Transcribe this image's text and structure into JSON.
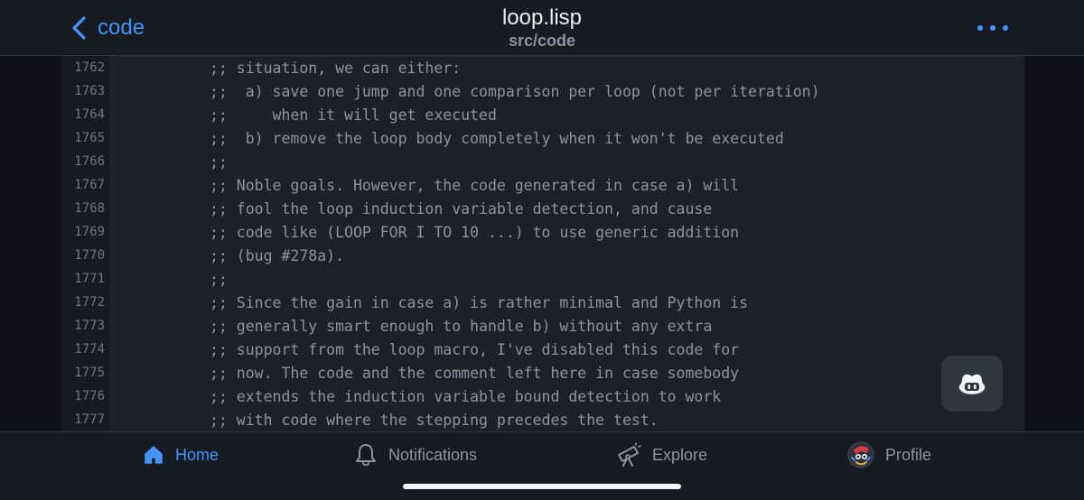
{
  "header": {
    "back_label": "code",
    "title": "loop.lisp",
    "subtitle": "src/code"
  },
  "code": {
    "lines": [
      {
        "num": "1762",
        "text": ";; situation, we can either:"
      },
      {
        "num": "1763",
        "text": ";;  a) save one jump and one comparison per loop (not per iteration)"
      },
      {
        "num": "1764",
        "text": ";;     when it will get executed"
      },
      {
        "num": "1765",
        "text": ";;  b) remove the loop body completely when it won't be executed"
      },
      {
        "num": "1766",
        "text": ";;"
      },
      {
        "num": "1767",
        "text": ";; Noble goals. However, the code generated in case a) will"
      },
      {
        "num": "1768",
        "text": ";; fool the loop induction variable detection, and cause"
      },
      {
        "num": "1769",
        "text": ";; code like (LOOP FOR I TO 10 ...) to use generic addition"
      },
      {
        "num": "1770",
        "text": ";; (bug #278a)."
      },
      {
        "num": "1771",
        "text": ";;"
      },
      {
        "num": "1772",
        "text": ";; Since the gain in case a) is rather minimal and Python is"
      },
      {
        "num": "1773",
        "text": ";; generally smart enough to handle b) without any extra"
      },
      {
        "num": "1774",
        "text": ";; support from the loop macro, I've disabled this code for"
      },
      {
        "num": "1775",
        "text": ";; now. The code and the comment left here in case somebody"
      },
      {
        "num": "1776",
        "text": ";; extends the induction variable bound detection to work"
      },
      {
        "num": "1777",
        "text": ";; with code where the stepping precedes the test."
      }
    ]
  },
  "tabbar": {
    "home": "Home",
    "notifications": "Notifications",
    "explore": "Explore",
    "profile": "Profile"
  },
  "colors": {
    "accent": "#4493f8",
    "background": "#0d1117",
    "code_background": "#1c2128",
    "muted_text": "#8b949e"
  },
  "icons": [
    "chevron-left-icon",
    "more-dots-icon",
    "copilot-icon",
    "home-icon",
    "bell-icon",
    "telescope-icon",
    "avatar"
  ]
}
